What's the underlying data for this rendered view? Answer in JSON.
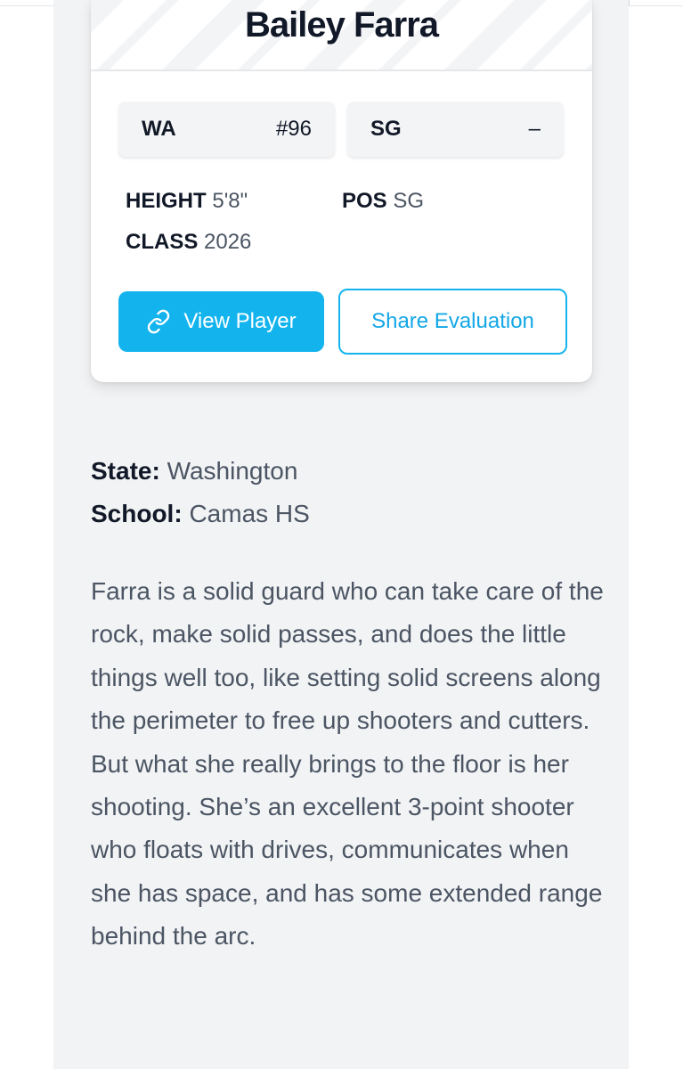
{
  "player": {
    "name": "Bailey Farra",
    "state_abbr": "WA",
    "number": "#96",
    "position_abbr": "SG",
    "position_extra": "–",
    "height_label": "HEIGHT",
    "height_value": "5'8\"",
    "pos_label": "POS",
    "pos_value": "SG",
    "class_label": "CLASS",
    "class_value": "2026"
  },
  "actions": {
    "view_player": "View Player",
    "share_evaluation": "Share Evaluation"
  },
  "details": {
    "state_label": "State:",
    "state_value": "Washington",
    "school_label": "School:",
    "school_value": "Camas HS"
  },
  "evaluation": {
    "text": "Farra is a solid guard who can take care of the rock, make solid passes, and does the little things well too, like setting solid screens along the perimeter to free up shooters and cutters. But what she really brings to the floor is her shooting. She’s an excellent 3-point shooter who floats with drives, communicates when she has space, and has some extended range behind the arc."
  },
  "colors": {
    "accent": "#13b4ee",
    "panel_bg": "#f2f3f5"
  },
  "icons": {
    "view_player": "link-icon"
  }
}
